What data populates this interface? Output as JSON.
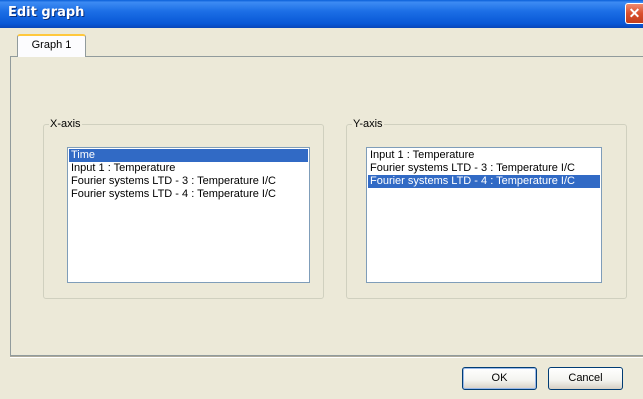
{
  "window": {
    "title": "Edit graph",
    "close_glyph": "✕"
  },
  "tabs": [
    {
      "label": "Graph 1",
      "selected": true
    }
  ],
  "x_axis": {
    "label": "X-axis",
    "items": [
      {
        "label": "Time",
        "selected": true
      },
      {
        "label": "Input 1 : Temperature",
        "selected": false
      },
      {
        "label": "Fourier systems LTD - 3 : Temperature I/C",
        "selected": false
      },
      {
        "label": "Fourier systems LTD - 4 : Temperature I/C",
        "selected": false
      }
    ]
  },
  "y_axis": {
    "label": "Y-axis",
    "items": [
      {
        "label": "Input 1 : Temperature",
        "selected": false
      },
      {
        "label": "Fourier systems LTD - 3 : Temperature I/C",
        "selected": false
      },
      {
        "label": "Fourier systems LTD - 4 : Temperature I/C",
        "selected": true
      }
    ]
  },
  "buttons": {
    "ok_label": "OK",
    "cancel_label": "Cancel"
  },
  "colors": {
    "titlebar": "#0a5fd8",
    "selection": "#316ac5",
    "dialog_bg": "#ece9d8"
  }
}
